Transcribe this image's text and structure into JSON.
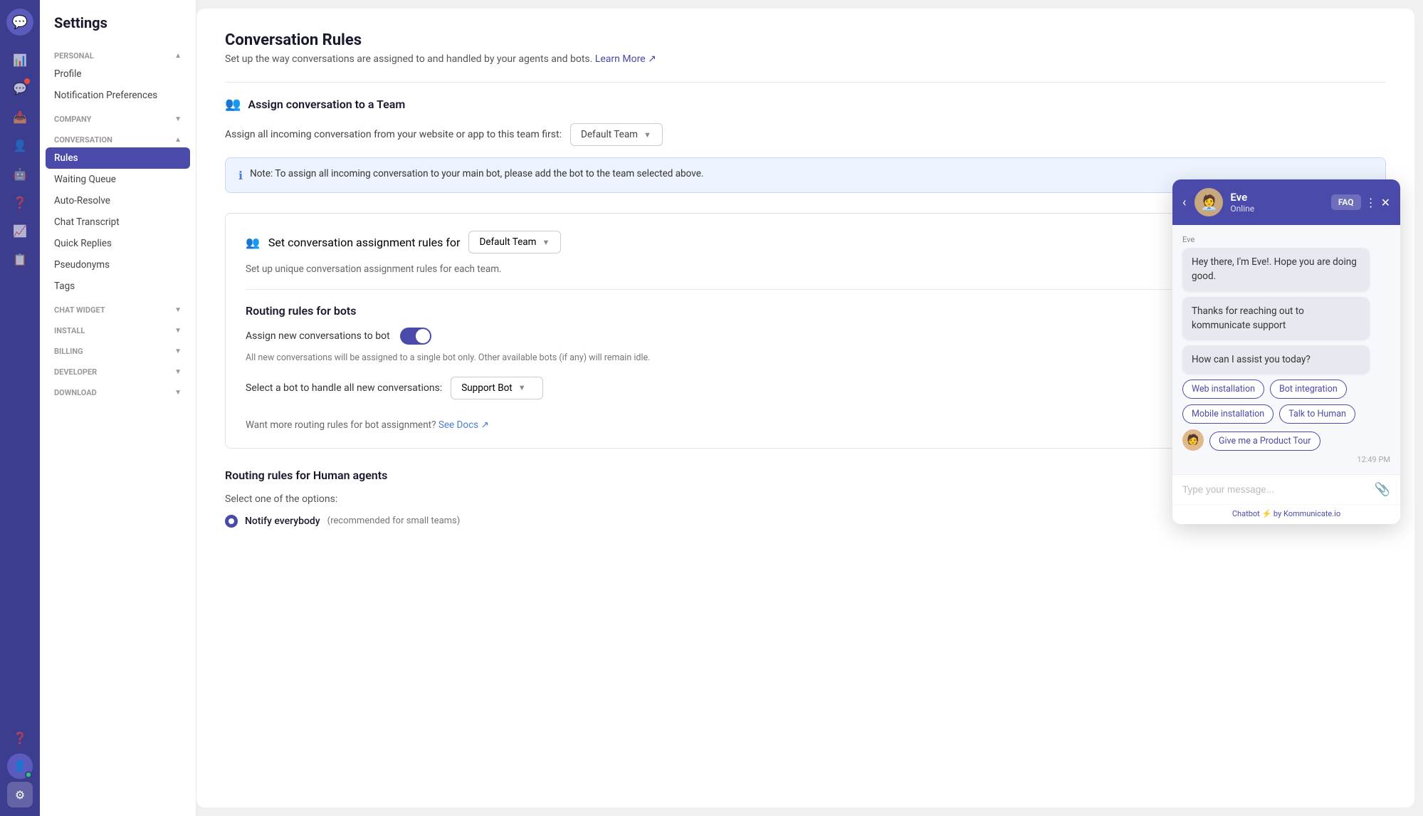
{
  "app": {
    "title": "Settings"
  },
  "icon_sidebar": {
    "logo": "💬",
    "icons": [
      {
        "name": "dashboard-icon",
        "symbol": "📊",
        "active": false
      },
      {
        "name": "chat-icon",
        "symbol": "💬",
        "active": false,
        "badge": true
      },
      {
        "name": "inbox-icon",
        "symbol": "📥",
        "active": false
      },
      {
        "name": "contacts-icon",
        "symbol": "👤",
        "active": false
      },
      {
        "name": "bot-icon",
        "symbol": "🤖",
        "active": false
      },
      {
        "name": "help-icon",
        "symbol": "❓",
        "active": false
      },
      {
        "name": "reports-icon",
        "symbol": "📈",
        "active": false
      },
      {
        "name": "campaigns-icon",
        "symbol": "📋",
        "active": false
      }
    ],
    "bottom_icons": [
      {
        "name": "help-bottom-icon",
        "symbol": "❓"
      },
      {
        "name": "settings-icon",
        "symbol": "⚙"
      }
    ]
  },
  "sidebar": {
    "title": "Settings",
    "sections": [
      {
        "name": "PERSONAL",
        "expanded": true,
        "items": [
          "Profile",
          "Notification Preferences"
        ]
      },
      {
        "name": "COMPANY",
        "expanded": false,
        "items": []
      },
      {
        "name": "CONVERSATION",
        "expanded": true,
        "items": [
          "Rules",
          "Waiting Queue",
          "Auto-Resolve",
          "Chat Transcript",
          "Quick Replies",
          "Pseudonyms",
          "Tags"
        ]
      },
      {
        "name": "CHAT WIDGET",
        "expanded": false,
        "items": []
      },
      {
        "name": "INSTALL",
        "expanded": false,
        "items": []
      },
      {
        "name": "BILLING",
        "expanded": false,
        "items": []
      },
      {
        "name": "DEVELOPER",
        "expanded": false,
        "items": []
      },
      {
        "name": "DOWNLOAD",
        "expanded": false,
        "items": []
      }
    ],
    "active_item": "Rules"
  },
  "page": {
    "title": "Conversation Rules",
    "subtitle": "Set up the way conversations are assigned to and handled by your agents and bots.",
    "learn_more": "Learn More",
    "assign_section_title": "Assign conversation to a Team",
    "assign_label": "Assign all incoming conversation from your website or app to this team first:",
    "default_team": "Default Team",
    "note_text": "Note: To assign all incoming conversation to your main bot, please add the bot to the team selected above.",
    "set_rules_label": "Set conversation assignment rules for",
    "set_rules_team": "Default Team",
    "set_rules_desc": "Set up unique conversation assignment rules for each team.",
    "routing_bots_title": "Routing rules for bots",
    "assign_bot_label": "Assign new conversations to bot",
    "bot_toggle_on": true,
    "bot_all_desc": "All new conversations will be assigned to a single bot only. Other available bots (if any) will remain idle.",
    "select_bot_label": "Select a bot to handle all new conversations:",
    "selected_bot": "Support Bot",
    "docs_text": "Want more routing rules for bot assignment?",
    "docs_link": "See Docs",
    "routing_human_title": "Routing rules for Human agents",
    "select_option_text": "Select one of the options:",
    "notify_everybody_label": "Notify everybody",
    "notify_everybody_sublabel": "(recommended for small teams)"
  },
  "chat_widget": {
    "agent_name": "Eve",
    "agent_status": "Online",
    "faq_label": "FAQ",
    "sender_label": "Eve",
    "message1": "Hey there, I'm Eve!. Hope you are doing good.",
    "message2": "Thanks for reaching out to kommunicate support",
    "message3": "How can I assist you today?",
    "chips": [
      "Web installation",
      "Bot integration",
      "Mobile installation",
      "Talk to Human"
    ],
    "user_chip": "Give me a Product Tour",
    "timestamp": "12:49 PM",
    "input_placeholder": "Type your message...",
    "footer_text": "Chatbot ⚡ by Kommunicate.io"
  }
}
